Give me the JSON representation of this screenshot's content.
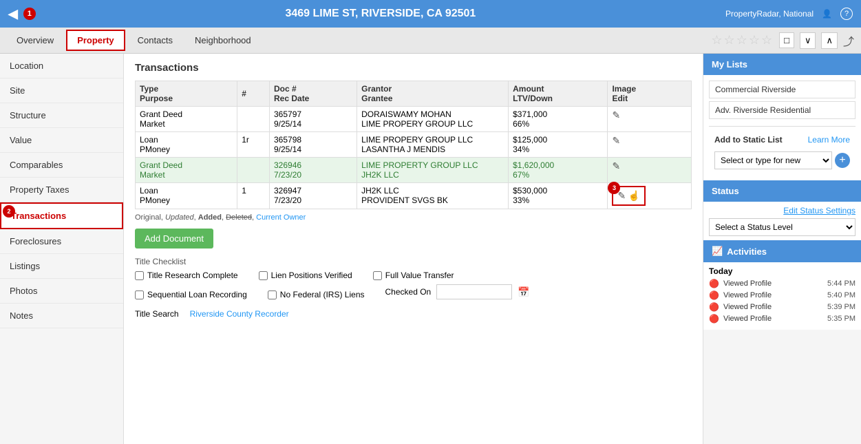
{
  "header": {
    "address": "3469 LIME ST, RIVERSIDE, CA 92501",
    "account": "PropertyRadar, National",
    "back_icon": "◀",
    "badge1": "1",
    "user_icon": "👤",
    "help_icon": "?"
  },
  "nav": {
    "tabs": [
      {
        "id": "overview",
        "label": "Overview",
        "active": false
      },
      {
        "id": "property",
        "label": "Property",
        "active": true
      },
      {
        "id": "contacts",
        "label": "Contacts",
        "active": false
      },
      {
        "id": "neighborhood",
        "label": "Neighborhood",
        "active": false
      }
    ],
    "stars": "☆☆☆☆☆",
    "nav_icons": [
      "□",
      "∨",
      "∧"
    ],
    "share_icon": "⤴"
  },
  "sidebar": {
    "items": [
      {
        "id": "location",
        "label": "Location"
      },
      {
        "id": "site",
        "label": "Site"
      },
      {
        "id": "structure",
        "label": "Structure"
      },
      {
        "id": "value",
        "label": "Value"
      },
      {
        "id": "comparables",
        "label": "Comparables"
      },
      {
        "id": "property-taxes",
        "label": "Property Taxes"
      },
      {
        "id": "transactions",
        "label": "Transactions",
        "active": true
      },
      {
        "id": "foreclosures",
        "label": "Foreclosures"
      },
      {
        "id": "listings",
        "label": "Listings"
      },
      {
        "id": "photos",
        "label": "Photos"
      },
      {
        "id": "notes",
        "label": "Notes"
      }
    ]
  },
  "content": {
    "section_title": "Transactions",
    "table": {
      "headers": [
        {
          "line1": "Type",
          "line2": "Purpose"
        },
        {
          "line1": "#",
          "line2": ""
        },
        {
          "line1": "Doc #",
          "line2": "Rec Date"
        },
        {
          "line1": "Grantor",
          "line2": "Grantee"
        },
        {
          "line1": "Amount",
          "line2": "LTV/Down"
        },
        {
          "line1": "Image",
          "line2": "Edit"
        }
      ],
      "rows": [
        {
          "type": "Grant Deed",
          "purpose": "Market",
          "num": "",
          "doc": "365797",
          "rec_date": "9/25/14",
          "grantor": "DORAISWAMY MOHAN",
          "grantee": "LIME PROPERY GROUP LLC",
          "amount": "$371,000",
          "ltv": "66%",
          "highlight": false
        },
        {
          "type": "Loan",
          "purpose": "PMoney",
          "num": "1r",
          "doc": "365798",
          "rec_date": "9/25/14",
          "grantor": "LIME PROPERY GROUP LLC",
          "grantee": "LASANTHA J MENDIS",
          "amount": "$125,000",
          "ltv": "34%",
          "highlight": false
        },
        {
          "type": "Grant Deed",
          "purpose": "Market",
          "num": "",
          "doc": "326946",
          "rec_date": "7/23/20",
          "grantor": "LIME PROPERTY GROUP LLC",
          "grantee": "JH2K LLC",
          "amount": "$1,620,000",
          "ltv": "67%",
          "highlight": true
        },
        {
          "type": "Loan",
          "purpose": "PMoney",
          "num": "1",
          "doc": "326947",
          "rec_date": "7/23/20",
          "grantor": "JH2K LLC",
          "grantee": "PROVIDENT SVGS BK",
          "amount": "$530,000",
          "ltv": "33%",
          "highlight": false,
          "edit_highlight": true
        }
      ]
    },
    "legend": {
      "original": "Original",
      "updated": "Updated",
      "added": "Added",
      "deleted": "Deleted",
      "current_owner": "Current Owner"
    },
    "add_document_label": "Add Document",
    "title_checklist": {
      "title": "Title Checklist",
      "items_row1": [
        {
          "id": "title-research",
          "label": "Title Research Complete",
          "checked": false
        },
        {
          "id": "lien-positions",
          "label": "Lien Positions Verified",
          "checked": false
        },
        {
          "id": "full-value",
          "label": "Full Value Transfer",
          "checked": false
        }
      ],
      "items_row2": [
        {
          "id": "sequential-loan",
          "label": "Sequential Loan Recording",
          "checked": false
        },
        {
          "id": "no-federal",
          "label": "No Federal (IRS) Liens",
          "checked": false
        }
      ],
      "checked_on_label": "Checked On",
      "checked_on_value": "",
      "title_search_label": "Title Search",
      "title_search_link": "Riverside County Recorder"
    }
  },
  "right_panel": {
    "my_lists": {
      "header": "My Lists",
      "lists": [
        {
          "name": "Commercial Riverside"
        },
        {
          "name": "Adv. Riverside Residential"
        }
      ],
      "add_static_label": "Add to Static List",
      "learn_more": "Learn More",
      "select_placeholder": "Select or type for new",
      "add_btn": "+"
    },
    "status": {
      "header": "Status",
      "edit_link": "Edit Status Settings",
      "select_placeholder": "Select a Status Level"
    },
    "activities": {
      "header": "Activities",
      "today_label": "Today",
      "items": [
        {
          "text": "Viewed Profile",
          "time": "5:44 PM"
        },
        {
          "text": "Viewed Profile",
          "time": "5:40 PM"
        },
        {
          "text": "Viewed Profile",
          "time": "5:39 PM"
        },
        {
          "text": "Viewed Profile",
          "time": "5:35 PM"
        }
      ]
    }
  },
  "badges": {
    "badge1": "1",
    "badge2": "2",
    "badge3": "3"
  }
}
